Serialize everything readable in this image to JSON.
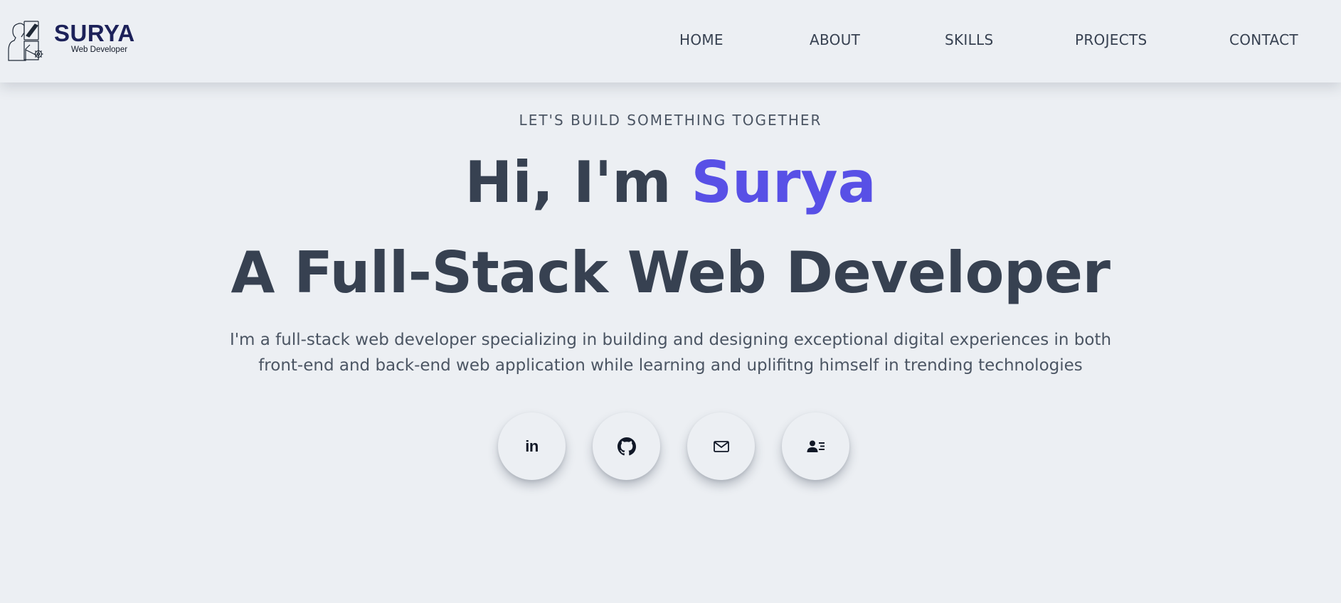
{
  "brand": {
    "name": "SURYA",
    "tagline": "Web Developer",
    "color": "#1c2159"
  },
  "nav": {
    "items": [
      {
        "label": "HOME"
      },
      {
        "label": "ABOUT"
      },
      {
        "label": "SKILLS"
      },
      {
        "label": "PROJECTS"
      },
      {
        "label": "CONTACT"
      }
    ]
  },
  "hero": {
    "eyebrow": "LET'S BUILD SOMETHING TOGETHER",
    "greeting": "Hi, I'm",
    "name": "Surya",
    "title": "A Full-Stack Web Developer",
    "description": "I'm a full-stack web developer specializing in building and designing exceptional digital experiences in both front-end and back-end web application while learning and uplifitng himself in trending technologies",
    "accent_color": "#5850e6"
  },
  "socials": [
    {
      "icon": "linkedin-icon",
      "glyph": "in"
    },
    {
      "icon": "github-icon"
    },
    {
      "icon": "mail-icon"
    },
    {
      "icon": "contact-card-icon"
    }
  ],
  "colors": {
    "background": "#eceff3",
    "text": "#374151",
    "muted": "#4b5563"
  }
}
